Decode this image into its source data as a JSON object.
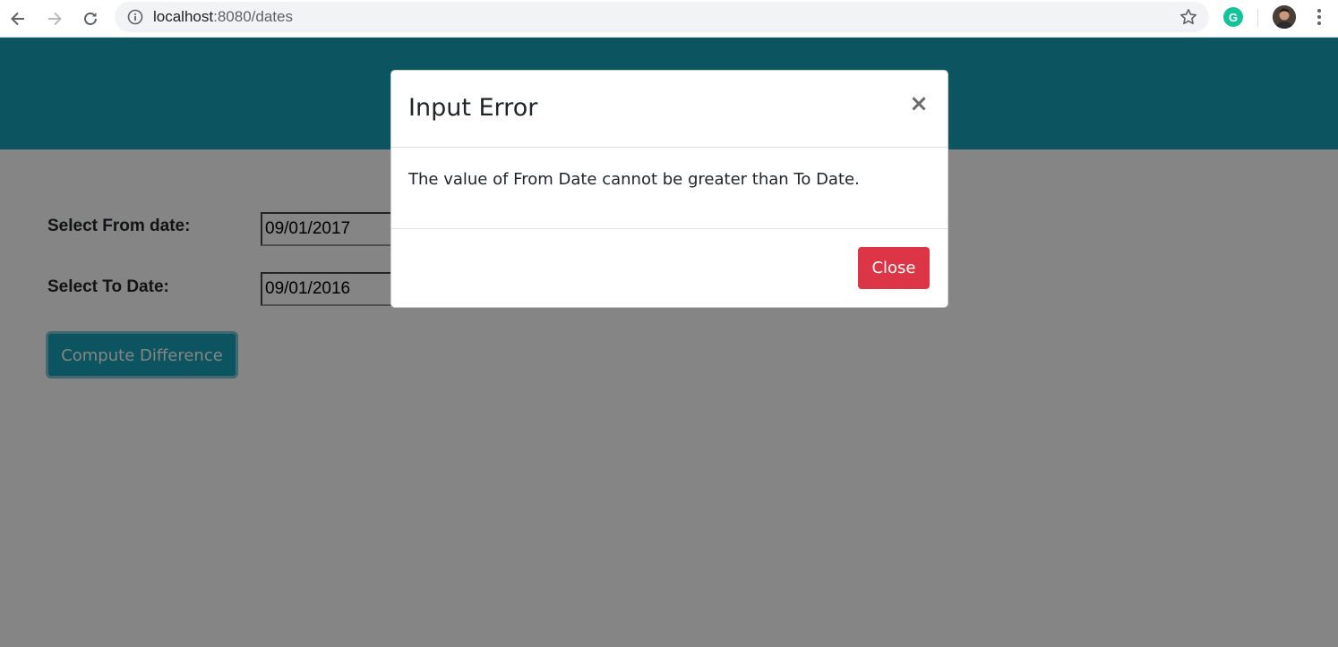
{
  "browser": {
    "url_host": "localhost",
    "url_path": ":8080/dates",
    "icons": [
      "back-arrow-icon",
      "forward-arrow-icon",
      "reload-icon",
      "info-icon",
      "star-icon",
      "grammarly-icon",
      "avatar",
      "menu-icon"
    ],
    "extension_letter": "G"
  },
  "page": {
    "header_color": "#17a2b8",
    "from_label": "Select From date:",
    "from_value": "09/01/2017",
    "to_label": "Select To Date:",
    "to_value": "09/01/2016",
    "compute_button": "Compute Difference"
  },
  "modal": {
    "title": "Input Error",
    "close_symbol": "×",
    "message": "The value of From Date cannot be greater than To Date.",
    "close_button": "Close",
    "close_button_color": "#dc3545"
  }
}
